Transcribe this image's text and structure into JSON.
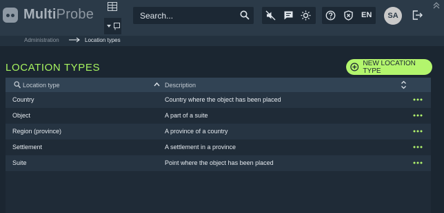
{
  "app": {
    "brand_prefix": "Multi",
    "brand_suffix": "Probe"
  },
  "header": {
    "search_placeholder": "Search...",
    "language": "EN",
    "avatar_initials": "SA"
  },
  "breadcrumb": {
    "parent": "Administration",
    "current": "Location types"
  },
  "page": {
    "title": "LOCATION TYPES",
    "new_button_label": "NEW LOCATION TYPE"
  },
  "table": {
    "columns": {
      "type": "Location type",
      "description": "Description"
    },
    "rows": [
      {
        "type": "Country",
        "description": "Country where the object has been placed"
      },
      {
        "type": "Object",
        "description": "A part of a suite"
      },
      {
        "type": "Region (province)",
        "description": "A province of a country"
      },
      {
        "type": "Settlement",
        "description": "A settlement in a province"
      },
      {
        "type": "Suite",
        "description": "Point where the object has been placed"
      }
    ]
  },
  "colors": {
    "accent": "#b3f56d",
    "title_green": "#a7f35f",
    "header_bg": "#2b3a48",
    "page_bg": "#1b2631"
  },
  "icons": {
    "logo": "multiprobe-logo-icon",
    "layout": "layout-grid-icon",
    "dropdown": "chevron-down-icon",
    "search": "search-icon",
    "mute": "mute-icon",
    "message": "message-icon",
    "theme": "sun-icon",
    "help": "help-icon",
    "security": "shield-icon",
    "logout": "logout-icon",
    "collapse": "chevrons-up-icon",
    "add": "plus-circle-icon",
    "row_menu": "more-horizontal-icon"
  }
}
